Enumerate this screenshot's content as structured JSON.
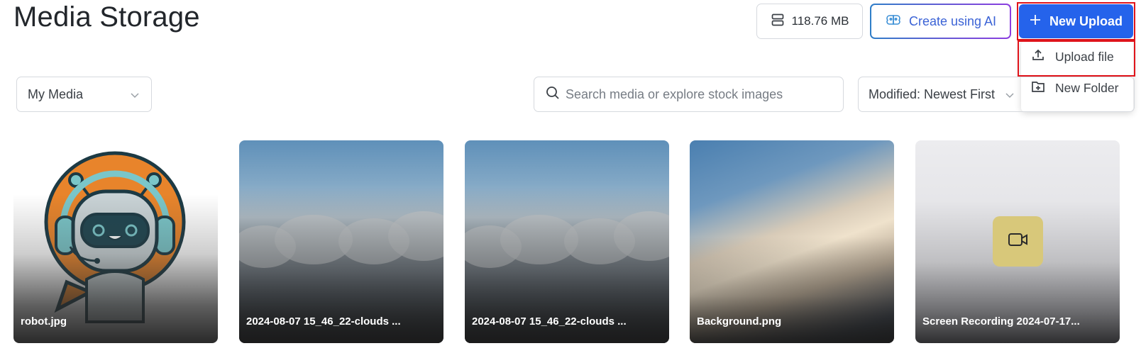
{
  "page": {
    "title": "Media Storage"
  },
  "header": {
    "storage_used": "118.76 MB",
    "create_ai_label": "Create using AI",
    "new_upload_label": "New Upload"
  },
  "upload_menu": {
    "items": [
      {
        "label": "Upload file",
        "icon": "upload-icon"
      },
      {
        "label": "New Folder",
        "icon": "folder-plus-icon"
      }
    ]
  },
  "filters": {
    "library_select": "My Media",
    "search_placeholder": "Search media or explore stock images",
    "sort_select": "Modified: Newest First"
  },
  "media": [
    {
      "name": "robot.jpg",
      "kind": "image"
    },
    {
      "name": "2024-08-07 15_46_22-clouds ...",
      "kind": "image"
    },
    {
      "name": "2024-08-07 15_46_22-clouds ...",
      "kind": "image"
    },
    {
      "name": "Background.png",
      "kind": "image"
    },
    {
      "name": "Screen Recording 2024-07-17...",
      "kind": "video"
    }
  ],
  "colors": {
    "primary": "#2563eb",
    "highlight_outline": "#e0141b",
    "ai_gradient_start": "#2f7ec8",
    "ai_gradient_end": "#8c3de0",
    "video_tile": "#d8c87a"
  }
}
